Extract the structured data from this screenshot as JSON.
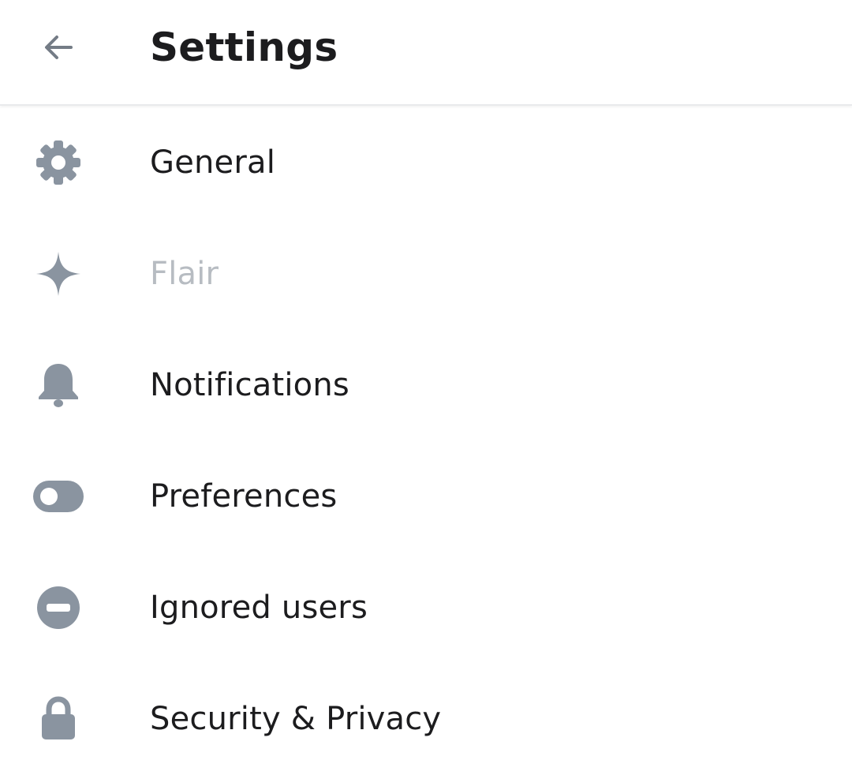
{
  "header": {
    "title": "Settings",
    "back_icon": "arrow-left-icon"
  },
  "colors": {
    "icon": "#8a94a0",
    "text": "#1c1c1e",
    "disabled_text": "#b7bcc2"
  },
  "settings": {
    "items": [
      {
        "label": "General",
        "icon": "gear-icon",
        "enabled": true
      },
      {
        "label": "Flair",
        "icon": "sparkle-icon",
        "enabled": false
      },
      {
        "label": "Notifications",
        "icon": "bell-icon",
        "enabled": true
      },
      {
        "label": "Preferences",
        "icon": "toggle-icon",
        "enabled": true
      },
      {
        "label": "Ignored users",
        "icon": "block-icon",
        "enabled": true
      },
      {
        "label": "Security & Privacy",
        "icon": "lock-icon",
        "enabled": true
      }
    ]
  }
}
